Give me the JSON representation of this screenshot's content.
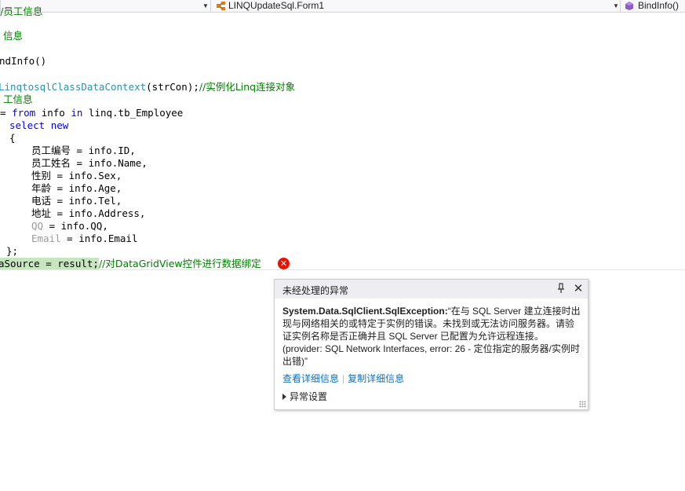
{
  "navigation_bar": {
    "class_dropdown": {
      "value": "LINQUpdateSql.Form1",
      "icon": "class-icon"
    },
    "member_dropdown": {
      "value": "BindInfo()",
      "icon": "method-icon"
    }
  },
  "code": {
    "line_0": "//员工信息",
    "line_1": "信息",
    "line_2_name": "ndInfo",
    "line_2_parens": "()",
    "line_3_type": "LinqtosqlClassDataContext",
    "line_3_args": "(strCon);",
    "line_3_comment": "//实例化Linq连接对象",
    "line_4": "工信息",
    "line_5_prefix": "= ",
    "line_5_from": "from",
    "line_5_var": " info ",
    "line_5_in": "in",
    "line_5_rest": " linq.tb_Employee",
    "line_6_select": "select",
    "line_6_new": "new",
    "line_7": "{",
    "fields": [
      {
        "name": "员工编号",
        "value": " = info.ID,"
      },
      {
        "name": "员工姓名",
        "value": " = info.Name,"
      },
      {
        "name": "性别",
        "value": " = info.Sex,"
      },
      {
        "name": "年龄",
        "value": " = info.Age,"
      },
      {
        "name": "电话",
        "value": " = info.Tel,"
      },
      {
        "name": "地址",
        "value": " = info.Address,"
      },
      {
        "name": "QQ",
        "value": " = info.QQ,"
      },
      {
        "name": "Email",
        "value": " = info.Email"
      }
    ],
    "line_close": "};",
    "error_line_code": "aSource = result;",
    "error_line_comment": "//对DataGridView控件进行数据绑定"
  },
  "exception_popup": {
    "title": "未经处理的异常",
    "exception_type": "System.Data.SqlClient.SqlException:",
    "message": "“在与 SQL Server 建立连接时出现与网络相关的或特定于实例的错误。未找到或无法访问服务器。请验证实例名称是否正确并且 SQL Server 已配置为允许远程连接。(provider: SQL Network Interfaces, error: 26 - 定位指定的服务器/实例时出错)”",
    "link_view_details": "查看详细信息",
    "link_copy_details": "复制详细信息",
    "exception_settings": "异常设置",
    "pin_glyph": "⊥",
    "close_glyph": "✕"
  },
  "colors": {
    "keyword": "#0000ff",
    "type": "#2b91af",
    "comment": "#008000",
    "error": "#e51400",
    "link": "#0e70c0",
    "highlight": "#c7e6c0"
  }
}
